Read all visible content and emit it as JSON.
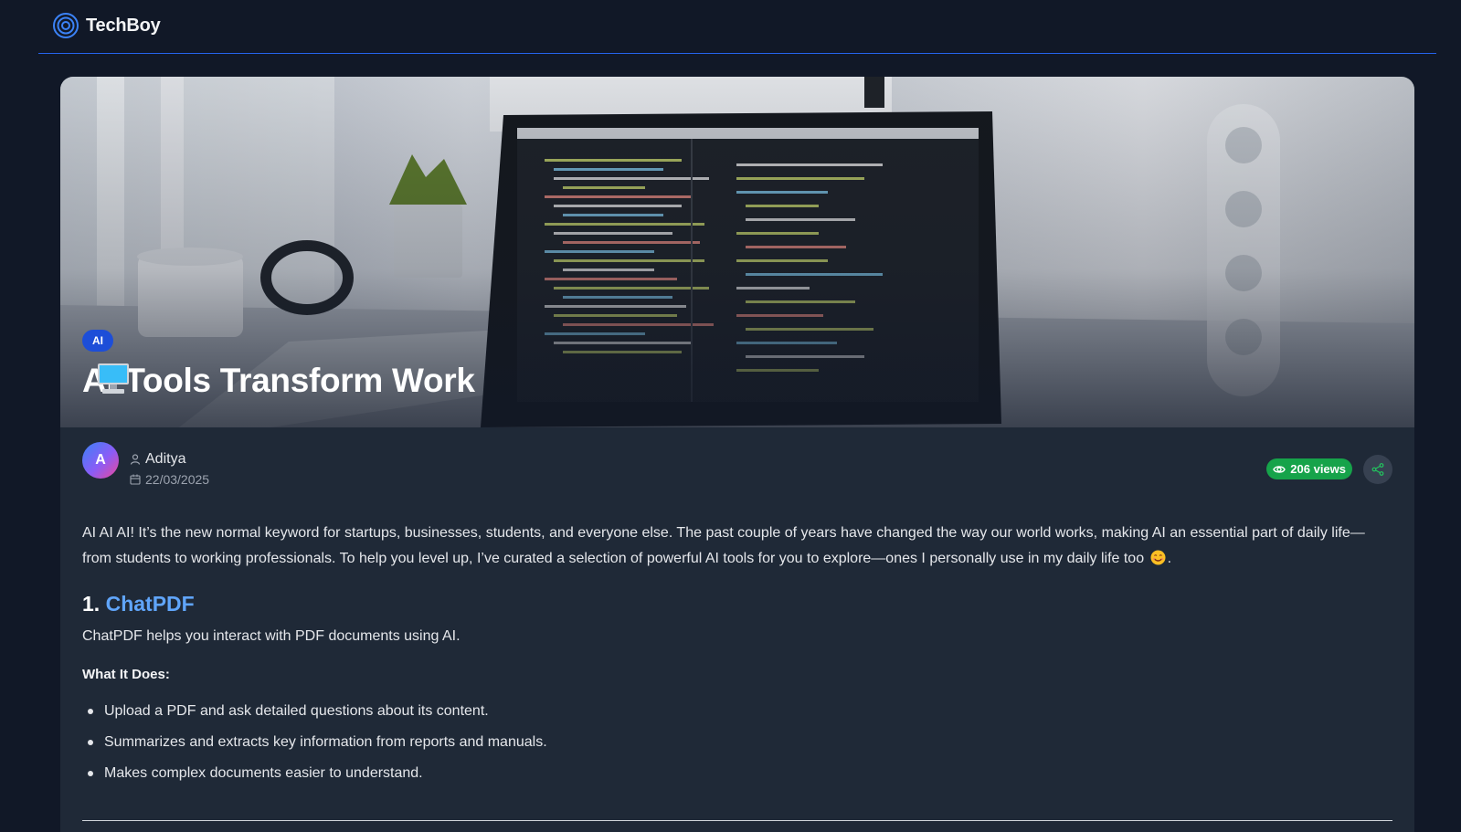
{
  "header": {
    "brand_name": "TechBoy",
    "logo_icon": "concentric-circles-icon",
    "accent_color": "#2563eb"
  },
  "post": {
    "category": "AI",
    "title": "AI Tools Transform Work",
    "title_emoji": "desktop-computer-icon",
    "author_initial": "A",
    "author_name": "Aditya",
    "date": "22/03/2025",
    "views_label": "206 views"
  },
  "article": {
    "intro": "AI AI AI! It’s the new normal keyword for startups, businesses, students, and everyone else. The past couple of years have changed the way our world works, making AI an essential part of daily life—from students to working professionals. To help you level up, I’ve curated a selection of powerful AI tools for you to explore—ones I personally use in my daily life too",
    "intro_end": ".",
    "sections": [
      {
        "number": "1.",
        "link_text": "ChatPDF",
        "description": "ChatPDF helps you interact with PDF documents using AI.",
        "what_heading": "What It Does:",
        "features": [
          "Upload a PDF and ask detailed questions about its content.",
          "Summarizes and extracts key information from reports and manuals.",
          "Makes complex documents easier to understand."
        ]
      }
    ]
  },
  "colors": {
    "page_bg": "#111827",
    "card_bg": "#1f2937",
    "link": "#60a5fa",
    "views_badge": "#16a34a",
    "category_badge": "#1d4ed8"
  }
}
